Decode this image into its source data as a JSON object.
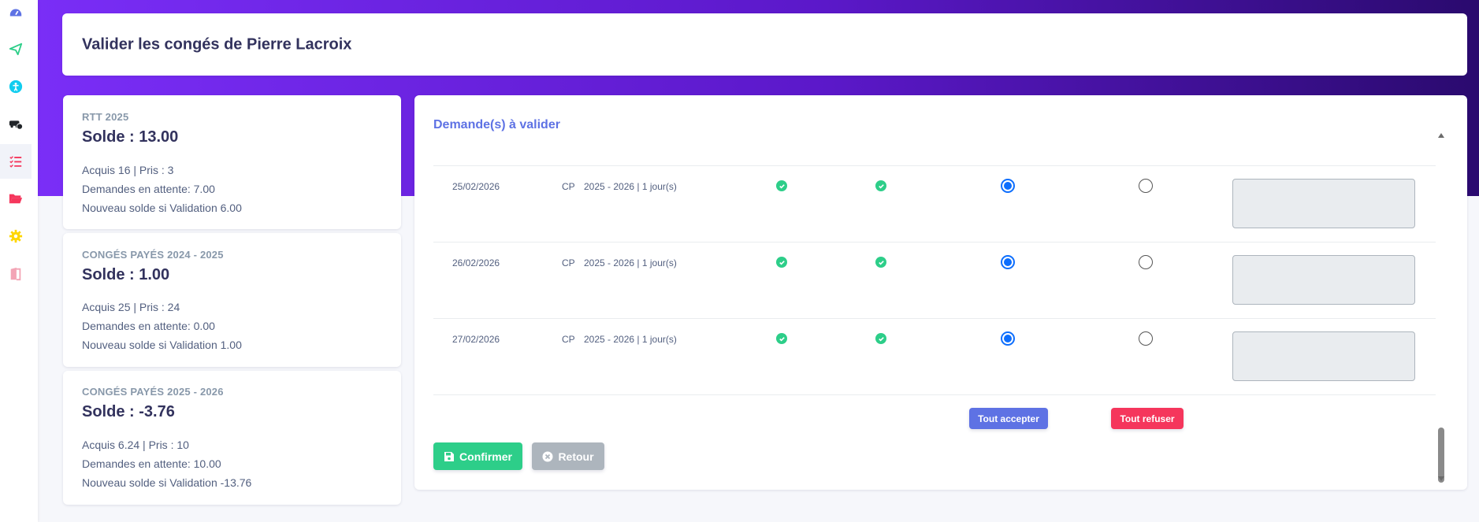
{
  "page": {
    "title": "Valider les congés de Pierre Lacroix"
  },
  "sidebar": {
    "items": [
      {
        "icon": "dashboard-icon",
        "color": "#5e72e4"
      },
      {
        "icon": "send-icon",
        "color": "#2dce89"
      },
      {
        "icon": "accessibility-icon",
        "color": "#11cdef"
      },
      {
        "icon": "car-clock-icon",
        "color": "#212529"
      },
      {
        "icon": "list-check-icon",
        "color": "#f5365c"
      },
      {
        "icon": "folder-open-icon",
        "color": "#f5365c"
      },
      {
        "icon": "gear-icon",
        "color": "#ffd600"
      },
      {
        "icon": "door-exit-icon",
        "color": "#f3a4b5"
      }
    ]
  },
  "balances": [
    {
      "header": "RTT 2025",
      "solde": "Solde : 13.00",
      "acquis": "Acquis 16 | Pris : 3",
      "attente": "Demandes en attente: 7.00",
      "nouveau": "Nouveau solde si Validation 6.00"
    },
    {
      "header": "CONGÉS PAYÉS 2024 - 2025",
      "solde": "Solde : 1.00",
      "acquis": "Acquis 25 | Pris : 24",
      "attente": "Demandes en attente: 0.00",
      "nouveau": "Nouveau solde si Validation 1.00"
    },
    {
      "header": "CONGÉS PAYÉS 2025 - 2026",
      "solde": "Solde : -3.76",
      "acquis": "Acquis 6.24 | Pris : 10",
      "attente": "Demandes en attente: 10.00",
      "nouveau": "Nouveau solde si Validation -13.76"
    }
  ],
  "requests": {
    "title": "Demande(s) à valider",
    "rows": [
      {
        "date": "25/02/2026",
        "type": "CP",
        "period": "2025 - 2026 | 1 jour(s)",
        "accept": true,
        "refuse": false,
        "comment": ""
      },
      {
        "date": "26/02/2026",
        "type": "CP",
        "period": "2025 - 2026 | 1 jour(s)",
        "accept": true,
        "refuse": false,
        "comment": ""
      },
      {
        "date": "27/02/2026",
        "type": "CP",
        "period": "2025 - 2026 | 1 jour(s)",
        "accept": true,
        "refuse": false,
        "comment": ""
      }
    ],
    "accept_all": "Tout accepter",
    "refuse_all": "Tout refuser",
    "confirm": "Confirmer",
    "back": "Retour"
  },
  "colors": {
    "primary": "#5e72e4",
    "success": "#2dce89",
    "danger": "#f5365c",
    "secondary": "#adb5bd",
    "radio": "#0d6efd",
    "hero_start": "#7a2ef7",
    "hero_end": "#2a0a6e"
  }
}
